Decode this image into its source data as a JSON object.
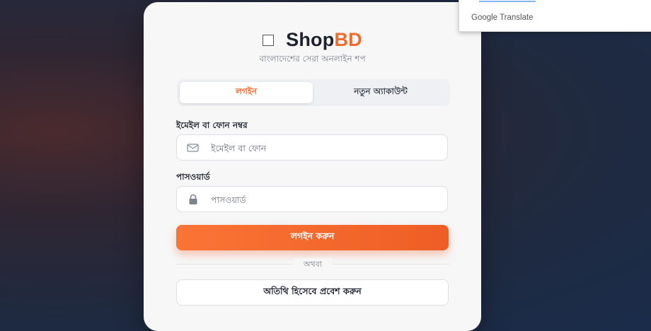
{
  "brand": {
    "name_prefix": "Shop",
    "name_suffix": "BD",
    "tagline": "বাংলাদেশের সেরা অনলাইন শপ"
  },
  "tabs": [
    {
      "label": "লগইন",
      "active": true
    },
    {
      "label": "নতুন অ্যাকাউন্ট",
      "active": false
    }
  ],
  "form": {
    "email_label": "ইমেইল বা ফোন নম্বর",
    "email_placeholder": "ইমেইল বা ফোন",
    "email_value": "",
    "password_label": "পাসওয়ার্ড",
    "password_placeholder": "পাসওয়ার্ড",
    "password_value": "",
    "submit_label": "লগইন করুন",
    "or_text": "অথবা",
    "guest_label": "অতিথি হিসেবে প্রবেশ করুন"
  },
  "translate_popup": {
    "label": "Google Translate"
  },
  "colors": {
    "accent": "#f06a2e",
    "brand_dark": "#1f2330",
    "card_bg": "#f7f7f8"
  },
  "icons": {
    "email": "envelope-icon",
    "password": "lock-icon",
    "logo": "broken-image-icon"
  }
}
